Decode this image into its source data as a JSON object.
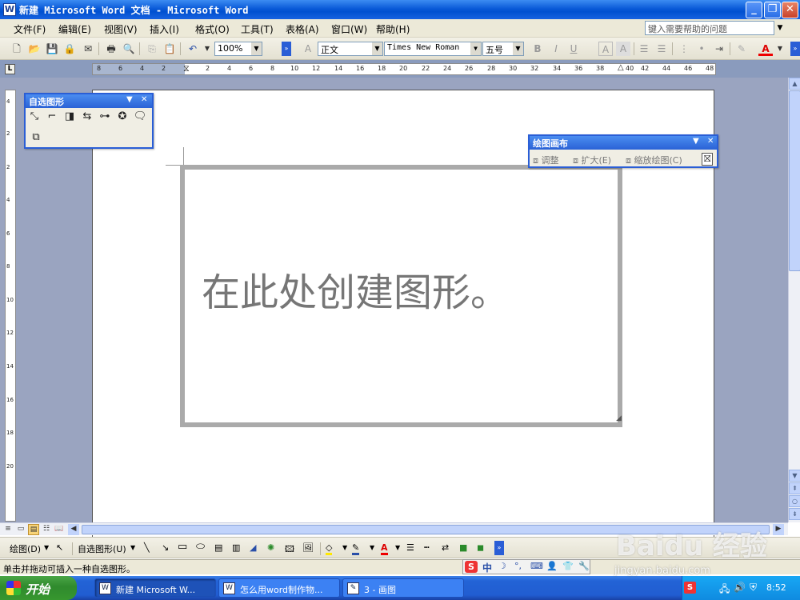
{
  "window": {
    "title": "新建 Microsoft Word 文档 - Microsoft Word",
    "app_icon": "W",
    "minimize": "_",
    "maximize": "❐",
    "close": "✕"
  },
  "menu": {
    "items": [
      "文件(F)",
      "编辑(E)",
      "视图(V)",
      "插入(I)",
      "格式(O)",
      "工具(T)",
      "表格(A)",
      "窗口(W)",
      "帮助(H)"
    ],
    "help_placeholder": "键入需要帮助的问题"
  },
  "toolbar": {
    "zoom": "100%",
    "style": "正文",
    "font": "Times New Roman",
    "size": "五号",
    "bold": "B",
    "italic": "I",
    "underline": "U",
    "char_border": "A",
    "char_shading": "A",
    "font_color": "A"
  },
  "ruler": {
    "horizontal_ticks": [
      "8",
      "6",
      "4",
      "2",
      "2",
      "4",
      "6",
      "8",
      "10",
      "12",
      "14",
      "16",
      "18",
      "20",
      "22",
      "24",
      "26",
      "28",
      "30",
      "32",
      "34",
      "36",
      "38",
      "40",
      "42",
      "44",
      "46",
      "48"
    ],
    "vertical_ticks": [
      "4",
      "2",
      "2",
      "4",
      "6",
      "8",
      "10",
      "12",
      "14",
      "16",
      "18",
      "20"
    ],
    "tab_selector": "L"
  },
  "canvas": {
    "placeholder_text": "在此处创建图形。"
  },
  "autoshapes_toolbar": {
    "title": "自选图形"
  },
  "canvas_toolbar": {
    "title": "绘图画布",
    "fit": "调整",
    "expand": "扩大(E)",
    "scale": "缩放绘图(C)"
  },
  "drawing_toolbar": {
    "draw": "绘图(D)",
    "autoshapes": "自选图形(U)"
  },
  "status": {
    "text": "单击并拖动可插入一种自选图形。",
    "ime_label": "中"
  },
  "taskbar": {
    "start": "开始",
    "tasks": [
      "新建 Microsoft W...",
      "怎么用word制作物...",
      "3 - 画图"
    ],
    "clock": "8:52"
  },
  "watermark": {
    "logo": "Baidu 经验",
    "url": "jingyan.baidu.com"
  },
  "colors": {
    "titlebar": "#0a5ad8",
    "menubar": "#ece9d8",
    "doc_background": "#9aa4c0",
    "panel_border": "#2a5ed6",
    "start_button": "#2f8a2d",
    "canvas_text": "#767676"
  }
}
